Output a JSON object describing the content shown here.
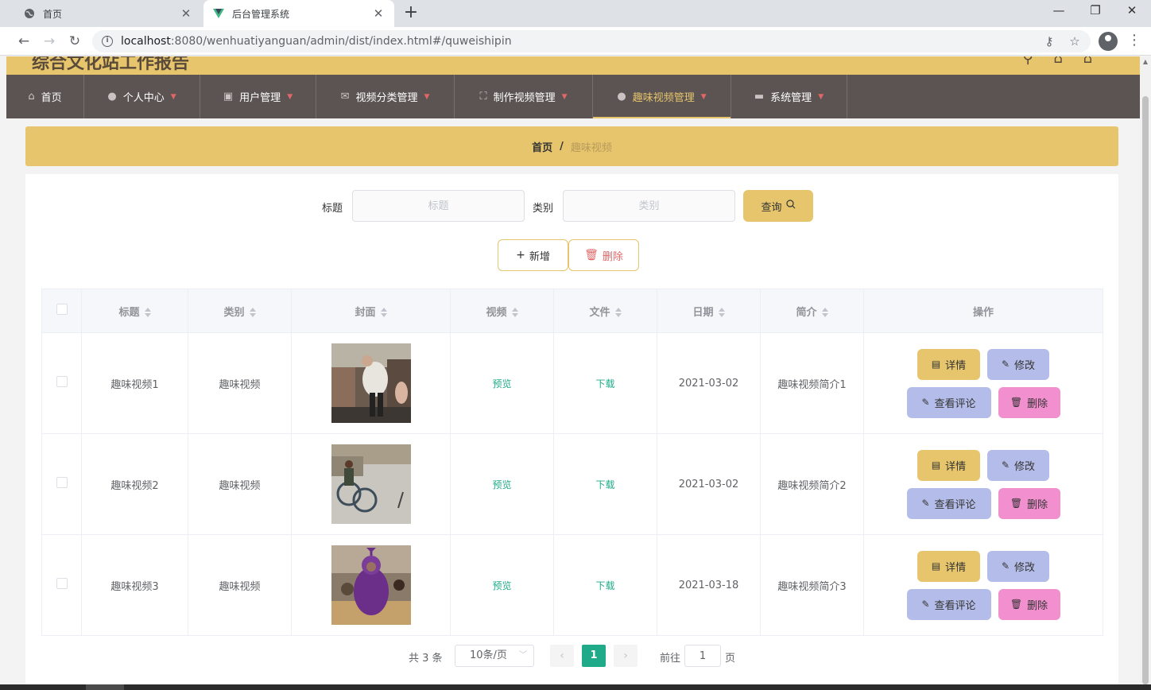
{
  "browser": {
    "tabs": [
      {
        "title": "首页",
        "favicon": "globe-icon",
        "active": false
      },
      {
        "title": "后台管理系统",
        "favicon": "vue-logo-icon",
        "active": true
      }
    ],
    "url_host": "localhost",
    "url_path": ":8080/wenhuatiyanguan/admin/dist/index.html#/quweishipin"
  },
  "site": {
    "title": "综合文化站工作报告"
  },
  "nav": [
    {
      "label": "首页",
      "icon": "home-icon",
      "caret": false,
      "active": false
    },
    {
      "label": "个人中心",
      "icon": "user-icon",
      "caret": true,
      "active": false
    },
    {
      "label": "用户管理",
      "icon": "clipboard-icon",
      "caret": true,
      "active": false
    },
    {
      "label": "视频分类管理",
      "icon": "mail-icon",
      "caret": true,
      "active": false
    },
    {
      "label": "制作视频管理",
      "icon": "fullscreen-icon",
      "caret": true,
      "active": false
    },
    {
      "label": "趣味视频管理",
      "icon": "user-icon",
      "caret": true,
      "active": true
    },
    {
      "label": "系统管理",
      "icon": "briefcase-icon",
      "caret": true,
      "active": false
    }
  ],
  "breadcrumb": {
    "home": "首页",
    "separator": "/",
    "current": "趣味视频"
  },
  "search": {
    "title_label": "标题",
    "title_placeholder": "标题",
    "category_label": "类别",
    "category_placeholder": "类别",
    "query_button": "查询"
  },
  "actions": {
    "add": "新增",
    "delete": "删除"
  },
  "table": {
    "headers": [
      "标题",
      "类别",
      "封面",
      "视频",
      "文件",
      "日期",
      "简介",
      "操作"
    ],
    "rows": [
      {
        "title": "趣味视频1",
        "category": "趣味视频",
        "cover": "cover-dancer",
        "video": "预览",
        "file": "下载",
        "date": "2021-03-02",
        "intro": "趣味视频简介1"
      },
      {
        "title": "趣味视频2",
        "category": "趣味视频",
        "cover": "cover-cyclist",
        "video": "预览",
        "file": "下载",
        "date": "2021-03-02",
        "intro": "趣味视频简介2"
      },
      {
        "title": "趣味视频3",
        "category": "趣味视频",
        "cover": "cover-purple-costume",
        "video": "预览",
        "file": "下载",
        "date": "2021-03-18",
        "intro": "趣味视频简介3"
      }
    ],
    "row_actions": {
      "detail": "详情",
      "edit": "修改",
      "comments": "查看评论",
      "delete": "删除"
    }
  },
  "pagination": {
    "total": "共 3 条",
    "page_size": "10条/页",
    "current_page": "1",
    "goto_label": "前往",
    "goto_value": "1",
    "goto_unit": "页"
  },
  "colors": {
    "accent": "#e6c56c",
    "nav_bg": "#5b5453",
    "link": "#1fab89",
    "delete_btn": "#f18fcf",
    "edit_btn": "#b4bde9"
  }
}
